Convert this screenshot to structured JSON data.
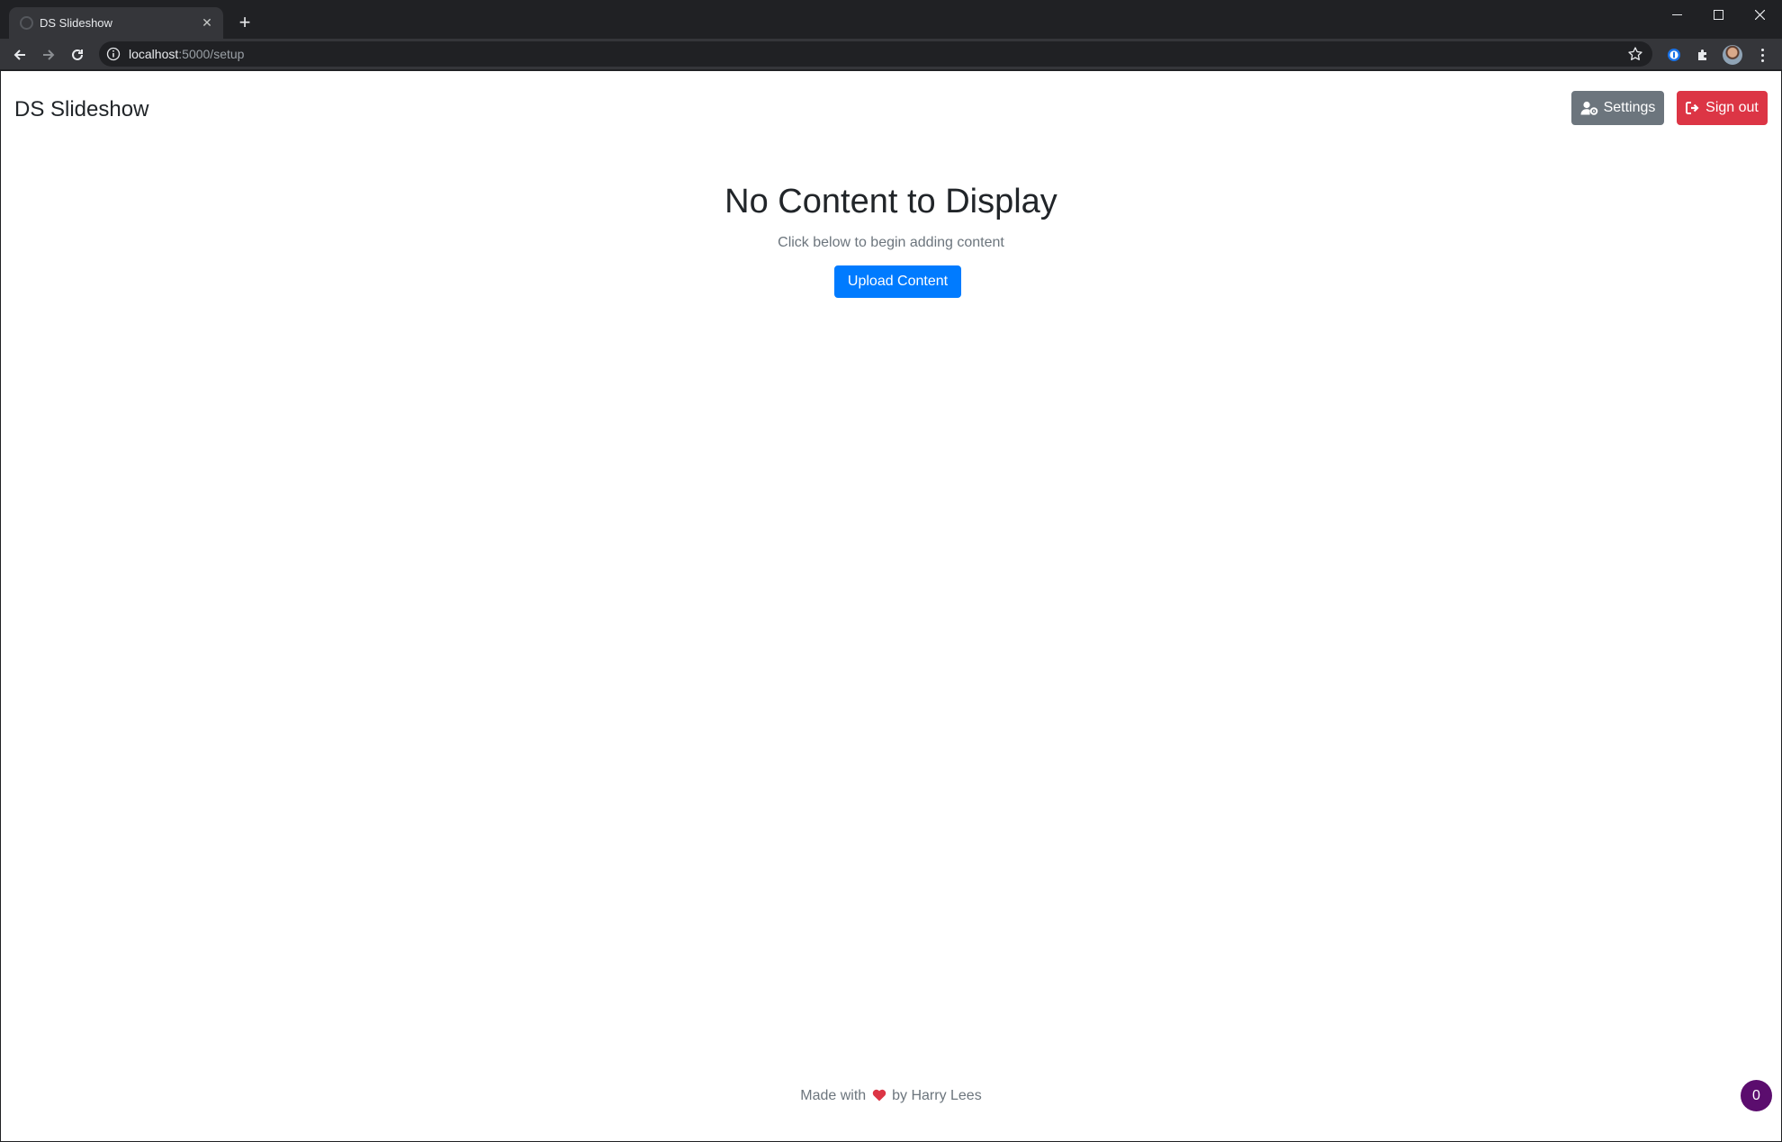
{
  "browser": {
    "tab_title": "DS Slideshow",
    "url_host": "localhost",
    "url_path": ":5000/setup"
  },
  "navbar": {
    "brand": "DS Slideshow",
    "settings_label": "Settings",
    "signout_label": "Sign out"
  },
  "main": {
    "heading": "No Content to Display",
    "subtext": "Click below to begin adding content",
    "upload_label": "Upload Content"
  },
  "footer": {
    "prefix": "Made with",
    "suffix": "by Harry Lees"
  },
  "badge": {
    "count": "0"
  },
  "colors": {
    "primary": "#007bff",
    "secondary": "#6c757d",
    "danger": "#dc3545",
    "badge": "#5b0d6e",
    "heart": "#dc3545"
  },
  "icons": {
    "settings_button": "user-gear-icon",
    "signout_button": "sign-out-icon",
    "footer": "heart-icon"
  }
}
